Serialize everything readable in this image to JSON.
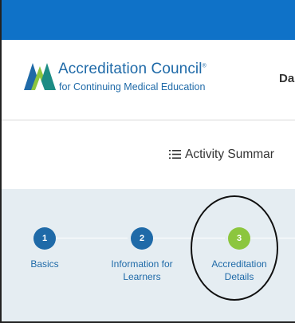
{
  "header": {
    "logo_title": "Accreditation Council",
    "logo_reg_mark": "®",
    "logo_subtitle": "for Continuing Medical Education",
    "nav_partial": "Da"
  },
  "summary": {
    "icon": "list-icon",
    "label": "Activity Summar"
  },
  "steps": [
    {
      "number": "1",
      "label": "Basics",
      "state": "complete"
    },
    {
      "number": "2",
      "label": "Information for Learners",
      "state": "complete"
    },
    {
      "number": "3",
      "label": "Accreditation Details",
      "state": "active"
    }
  ],
  "colors": {
    "top_bar": "#0f72c8",
    "brand_blue": "#1f6aa8",
    "active_step": "#8cc63e",
    "steps_panel_bg": "#e5edf2"
  }
}
